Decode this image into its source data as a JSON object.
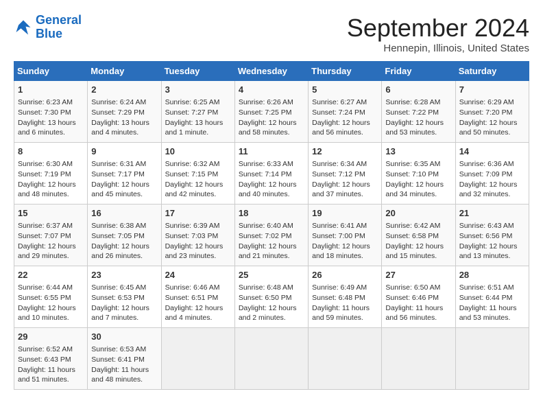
{
  "header": {
    "logo_line1": "General",
    "logo_line2": "Blue",
    "month": "September 2024",
    "location": "Hennepin, Illinois, United States"
  },
  "columns": [
    "Sunday",
    "Monday",
    "Tuesday",
    "Wednesday",
    "Thursday",
    "Friday",
    "Saturday"
  ],
  "weeks": [
    [
      {
        "day": "1",
        "sunrise": "6:23 AM",
        "sunset": "7:30 PM",
        "daylight": "13 hours and 6 minutes."
      },
      {
        "day": "2",
        "sunrise": "6:24 AM",
        "sunset": "7:29 PM",
        "daylight": "13 hours and 4 minutes."
      },
      {
        "day": "3",
        "sunrise": "6:25 AM",
        "sunset": "7:27 PM",
        "daylight": "13 hours and 1 minute."
      },
      {
        "day": "4",
        "sunrise": "6:26 AM",
        "sunset": "7:25 PM",
        "daylight": "12 hours and 58 minutes."
      },
      {
        "day": "5",
        "sunrise": "6:27 AM",
        "sunset": "7:24 PM",
        "daylight": "12 hours and 56 minutes."
      },
      {
        "day": "6",
        "sunrise": "6:28 AM",
        "sunset": "7:22 PM",
        "daylight": "12 hours and 53 minutes."
      },
      {
        "day": "7",
        "sunrise": "6:29 AM",
        "sunset": "7:20 PM",
        "daylight": "12 hours and 50 minutes."
      }
    ],
    [
      {
        "day": "8",
        "sunrise": "6:30 AM",
        "sunset": "7:19 PM",
        "daylight": "12 hours and 48 minutes."
      },
      {
        "day": "9",
        "sunrise": "6:31 AM",
        "sunset": "7:17 PM",
        "daylight": "12 hours and 45 minutes."
      },
      {
        "day": "10",
        "sunrise": "6:32 AM",
        "sunset": "7:15 PM",
        "daylight": "12 hours and 42 minutes."
      },
      {
        "day": "11",
        "sunrise": "6:33 AM",
        "sunset": "7:14 PM",
        "daylight": "12 hours and 40 minutes."
      },
      {
        "day": "12",
        "sunrise": "6:34 AM",
        "sunset": "7:12 PM",
        "daylight": "12 hours and 37 minutes."
      },
      {
        "day": "13",
        "sunrise": "6:35 AM",
        "sunset": "7:10 PM",
        "daylight": "12 hours and 34 minutes."
      },
      {
        "day": "14",
        "sunrise": "6:36 AM",
        "sunset": "7:09 PM",
        "daylight": "12 hours and 32 minutes."
      }
    ],
    [
      {
        "day": "15",
        "sunrise": "6:37 AM",
        "sunset": "7:07 PM",
        "daylight": "12 hours and 29 minutes."
      },
      {
        "day": "16",
        "sunrise": "6:38 AM",
        "sunset": "7:05 PM",
        "daylight": "12 hours and 26 minutes."
      },
      {
        "day": "17",
        "sunrise": "6:39 AM",
        "sunset": "7:03 PM",
        "daylight": "12 hours and 23 minutes."
      },
      {
        "day": "18",
        "sunrise": "6:40 AM",
        "sunset": "7:02 PM",
        "daylight": "12 hours and 21 minutes."
      },
      {
        "day": "19",
        "sunrise": "6:41 AM",
        "sunset": "7:00 PM",
        "daylight": "12 hours and 18 minutes."
      },
      {
        "day": "20",
        "sunrise": "6:42 AM",
        "sunset": "6:58 PM",
        "daylight": "12 hours and 15 minutes."
      },
      {
        "day": "21",
        "sunrise": "6:43 AM",
        "sunset": "6:56 PM",
        "daylight": "12 hours and 13 minutes."
      }
    ],
    [
      {
        "day": "22",
        "sunrise": "6:44 AM",
        "sunset": "6:55 PM",
        "daylight": "12 hours and 10 minutes."
      },
      {
        "day": "23",
        "sunrise": "6:45 AM",
        "sunset": "6:53 PM",
        "daylight": "12 hours and 7 minutes."
      },
      {
        "day": "24",
        "sunrise": "6:46 AM",
        "sunset": "6:51 PM",
        "daylight": "12 hours and 4 minutes."
      },
      {
        "day": "25",
        "sunrise": "6:48 AM",
        "sunset": "6:50 PM",
        "daylight": "12 hours and 2 minutes."
      },
      {
        "day": "26",
        "sunrise": "6:49 AM",
        "sunset": "6:48 PM",
        "daylight": "11 hours and 59 minutes."
      },
      {
        "day": "27",
        "sunrise": "6:50 AM",
        "sunset": "6:46 PM",
        "daylight": "11 hours and 56 minutes."
      },
      {
        "day": "28",
        "sunrise": "6:51 AM",
        "sunset": "6:44 PM",
        "daylight": "11 hours and 53 minutes."
      }
    ],
    [
      {
        "day": "29",
        "sunrise": "6:52 AM",
        "sunset": "6:43 PM",
        "daylight": "11 hours and 51 minutes."
      },
      {
        "day": "30",
        "sunrise": "6:53 AM",
        "sunset": "6:41 PM",
        "daylight": "11 hours and 48 minutes."
      },
      null,
      null,
      null,
      null,
      null
    ]
  ]
}
